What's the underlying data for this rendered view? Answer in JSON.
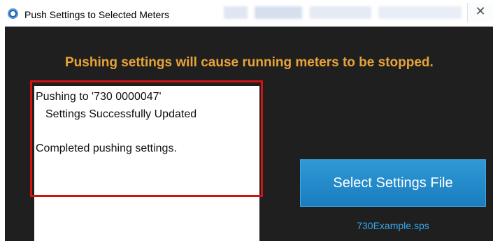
{
  "window": {
    "title": "Push Settings to Selected Meters",
    "close_glyph": "✕"
  },
  "dialog": {
    "warning": "Pushing settings will cause running meters to be stopped.",
    "log": {
      "line1": "Pushing to '730 0000047'",
      "line2": "Settings Successfully Updated",
      "line3": "Completed pushing settings."
    },
    "select_button_label": "Select Settings File",
    "selected_file": "730Example.sps"
  },
  "colors": {
    "dialog_bg": "#1f1f1f",
    "warning_text": "#e8a338",
    "button_bg": "#1f8ccb",
    "link_text": "#37a7ee",
    "highlight_border": "#d31212"
  },
  "icons": {
    "app": "app-icon",
    "close": "close-icon"
  }
}
